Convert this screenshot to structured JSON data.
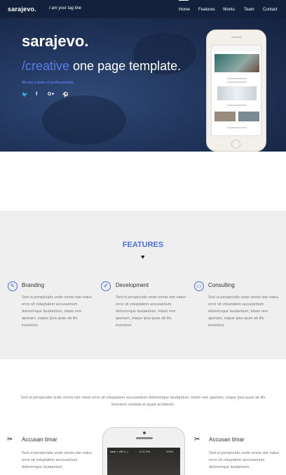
{
  "nav": {
    "brand": "sarajevo.",
    "tagline": "I am your tag line",
    "items": [
      "Home",
      "Features",
      "Works",
      "Team",
      "Contact"
    ],
    "active": "Home"
  },
  "hero": {
    "title": "sarajevo.",
    "subtitle_accent": "/creative",
    "subtitle_rest": " one page template.",
    "team_text": "We are a team of professionals.",
    "social_icons": [
      "twitter-icon",
      "facebook-icon",
      "google-plus-icon",
      "dribbble-icon"
    ],
    "social_glyphs": [
      "🐦",
      "f",
      "G+",
      "⚽"
    ]
  },
  "features": {
    "title": "FEATURES",
    "divider_glyph": "♥",
    "items": [
      {
        "name": "Branding",
        "icon": "pencil-icon",
        "glyph": "✎",
        "desc": "Sed ut perspiciatis unde omnis iste natus error sit voluptatem accusantium doloremque laudantium, totam rem aperiam, eaque ipsa quae ab illo inventore"
      },
      {
        "name": "Development",
        "icon": "pen-icon",
        "glyph": "✐",
        "desc": "Sed ut perspiciatis unde omnis iste natus error sit voluptatem accusantium doloremque laudantium, totam rem aperiam, eaque ipsa quae ab illo inventore"
      },
      {
        "name": "Consulting",
        "icon": "ticket-icon",
        "glyph": "▭",
        "desc": "Sed ut perspiciatis unde omnis iste natus error sit voluptatem accusantium doloremque laudantium, totam rem aperiam, eaque ipsa quae ab illo inventore"
      }
    ]
  },
  "services": {
    "intro": "Sed ut perspiciatis unde omnis iste natus error sit voluptatem accusantium doloremque laudantium, totam rem aperiam, eaque ipsa quae ab illo inventore veritatis et quasi architecto.",
    "left": {
      "name": "Accusan timar",
      "icon": "tools-icon",
      "glyph": "✂",
      "desc": "Sed ut perspiciatis unde omnis iste natus error sit voluptatem accusantium doloremque laudantium,"
    },
    "right": {
      "name": "Accusan timar",
      "icon": "tools-icon",
      "glyph": "✂",
      "desc": "Sed ut perspiciatis unde omnis iste natus error sit voluptatem accusantium doloremque laudantium,"
    },
    "phone_status": {
      "carrier": "●●●○○ BELL ≈",
      "time": "4:21 PM",
      "battery": "100%"
    }
  },
  "colors": {
    "accent": "#4a6fd8",
    "nav_bg": "#14213c",
    "features_bg": "#efefef"
  }
}
